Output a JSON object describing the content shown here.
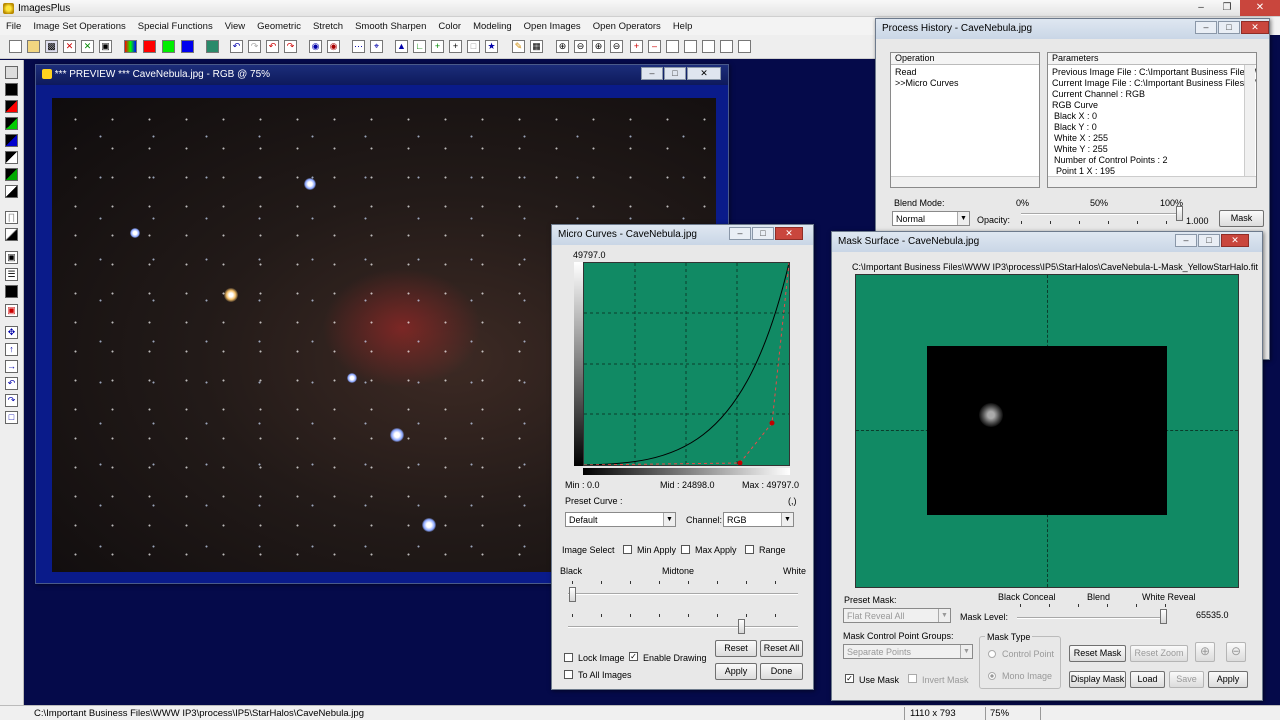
{
  "app": {
    "title": "ImagesPlus"
  },
  "menu": [
    "File",
    "Image Set Operations",
    "Special Functions",
    "View",
    "Geometric",
    "Stretch",
    "Smooth Sharpen",
    "Color",
    "Modeling",
    "Open Images",
    "Open Operators",
    "Help"
  ],
  "preview": {
    "title": "*** PREVIEW *** CaveNebula.jpg - RGB @ 75%"
  },
  "curves": {
    "title": "Micro Curves - CaveNebula.jpg",
    "top_value": "49797.0",
    "min_label": "Min : 0.0",
    "mid_label": "Mid : 24898.0",
    "max_label": "Max : 49797.0",
    "coord": "(,)",
    "preset_label": "Preset Curve :",
    "preset_value": "Default",
    "channel_label": "Channel:",
    "channel_value": "RGB",
    "image_select": "Image Select",
    "min_apply": "Min Apply",
    "max_apply": "Max Apply",
    "range": "Range",
    "black": "Black",
    "midtone": "Midtone",
    "white": "White",
    "reset": "Reset",
    "reset_all": "Reset All",
    "lock_image": "Lock Image",
    "enable_drawing": "Enable Drawing",
    "to_all_images": "To All Images",
    "apply": "Apply",
    "done": "Done",
    "enable_drawing_checked": true
  },
  "history": {
    "title": "Process History - CaveNebula.jpg",
    "col_operation": "Operation",
    "col_parameters": "Parameters",
    "operations": [
      "Read",
      ">>Micro Curves"
    ],
    "parameters": [
      "Previous Image File : C:\\Important Business Files\\WW",
      "Current Image File : C:\\Important Business Files\\WW",
      "Current Channel : RGB",
      "RGB Curve",
      " Black X : 0",
      " Black Y : 0",
      " White X : 255",
      " White Y : 255",
      " Number of Control Points : 2",
      "  Point 1 X : 195"
    ],
    "blend_mode_label": "Blend Mode:",
    "blend_mode_value": "Normal",
    "opacity_label": "Opacity:",
    "pct0": "0%",
    "pct50": "50%",
    "pct100": "100%",
    "opacity_value": "1.000",
    "mask_button": "Mask"
  },
  "mask": {
    "title": "Mask Surface - CaveNebula.jpg",
    "path": "C:\\Important Business Files\\WWW IP3\\process\\IP5\\StarHalos\\CaveNebula-L-Mask_YellowStarHalo.fit",
    "preset_label": "Preset Mask:",
    "preset_value": "Flat Reveal All",
    "black_conceal": "Black Conceal",
    "blend": "Blend",
    "white_reveal": "White Reveal",
    "mask_level_label": "Mask Level:",
    "mask_level_value": "65535.0",
    "groups_label": "Mask Control Point Groups:",
    "groups_value": "Separate Points",
    "mask_type_label": "Mask Type",
    "control_point": "Control Point",
    "mono_image": "Mono Image",
    "reset_mask": "Reset Mask",
    "reset_zoom": "Reset Zoom",
    "use_mask": "Use Mask",
    "invert_mask": "Invert Mask",
    "display_mask": "Display Mask",
    "load": "Load",
    "save": "Save",
    "apply": "Apply",
    "use_mask_checked": true
  },
  "status": {
    "path": "C:\\Important Business Files\\WWW IP3\\process\\IP5\\StarHalos\\CaveNebula.jpg",
    "dims": "1110 x 793",
    "zoom": "75%"
  },
  "colors": {
    "curve_bg": "#118a64",
    "desktop": "#050a4a",
    "frame": "#0a1b8a"
  }
}
